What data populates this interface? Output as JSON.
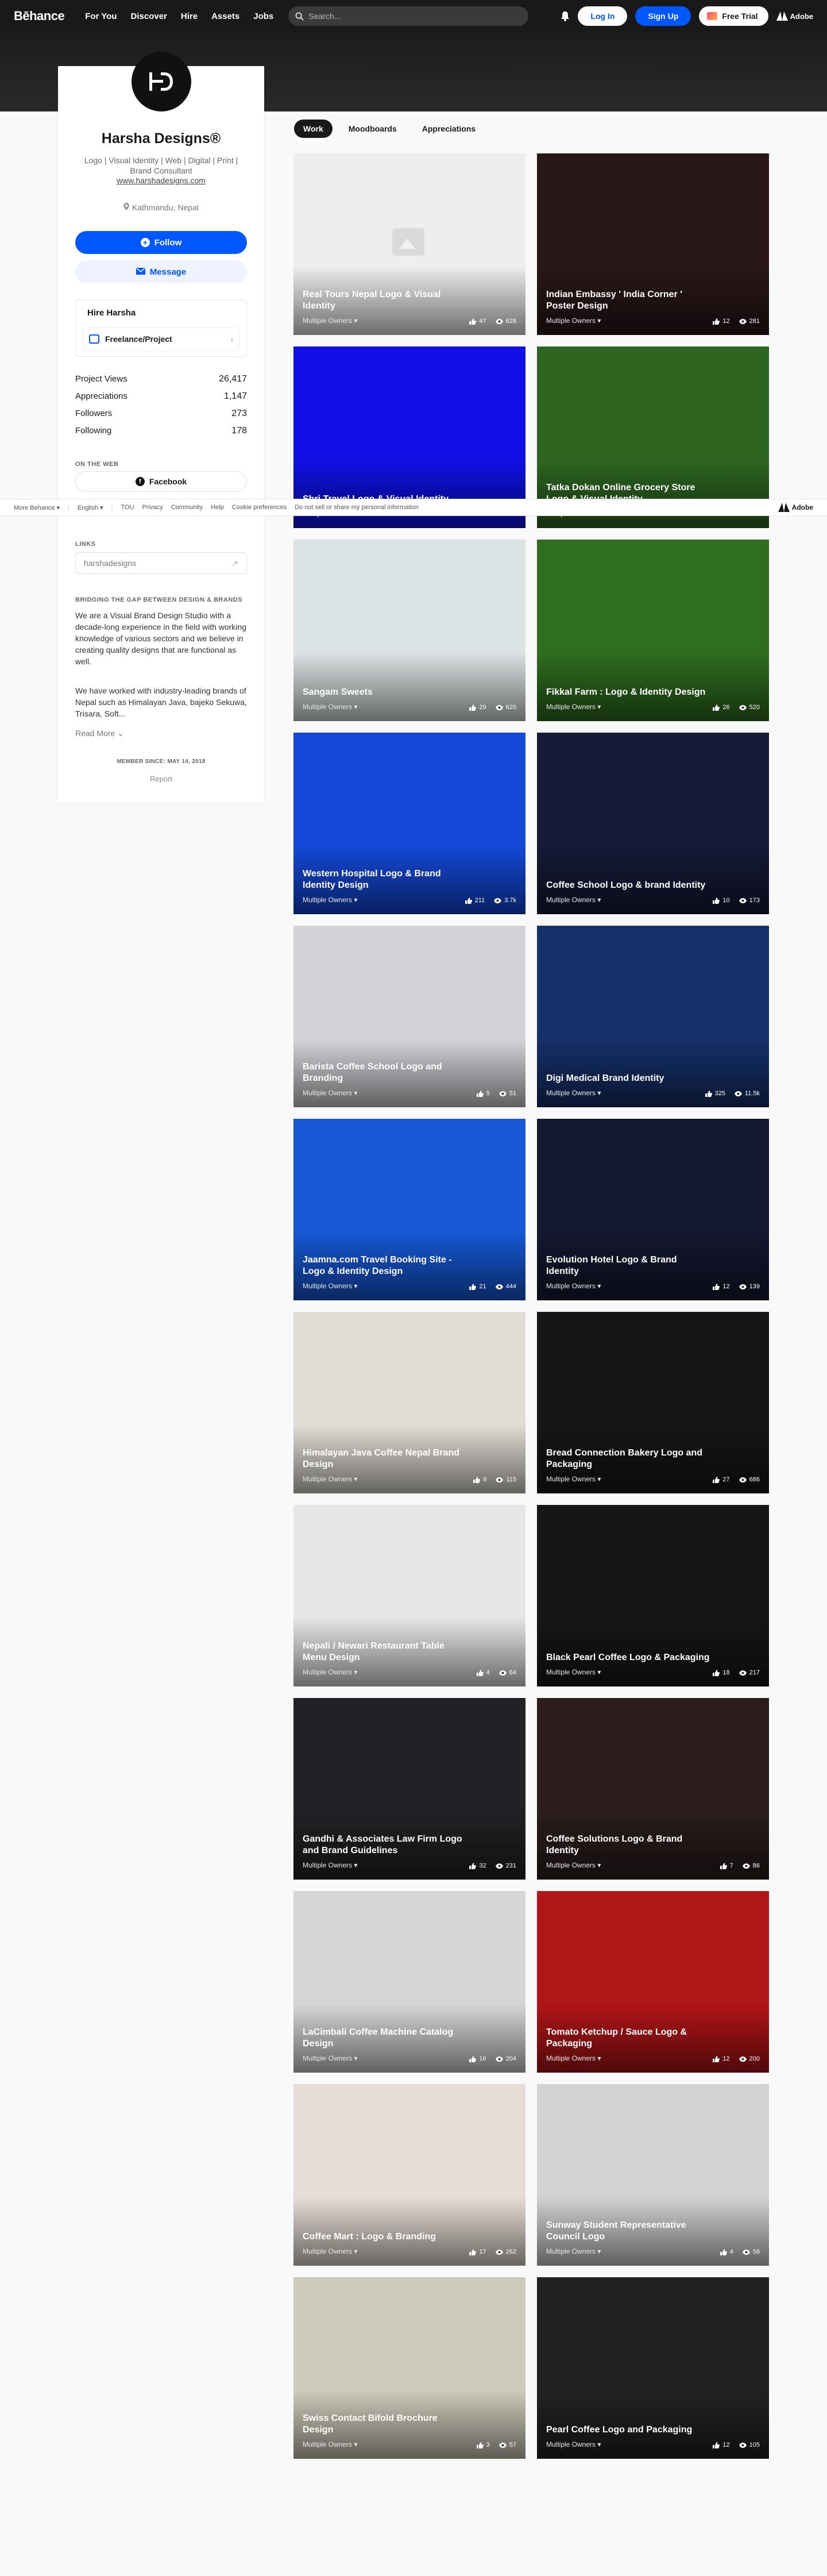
{
  "nav": {
    "logo": "Bēhance",
    "links": [
      "For You",
      "Discover",
      "Hire",
      "Assets",
      "Jobs"
    ],
    "search_placeholder": "Search...",
    "login": "Log In",
    "signup": "Sign Up",
    "free_trial": "Free Trial",
    "adobe": "Adobe"
  },
  "profile": {
    "name": "Harsha Designs®",
    "tagline": "Logo | Visual Identity | Web | Digital | Print | Brand Consultant",
    "website": "www.harshadesigns.com",
    "location": "Kathmandu, Nepal",
    "follow": "Follow",
    "message": "Message",
    "hire_title": "Hire Harsha",
    "hire_option": "Freelance/Project",
    "stats": [
      {
        "label": "Project Views",
        "value": "26,417"
      },
      {
        "label": "Appreciations",
        "value": "1,147"
      },
      {
        "label": "Followers",
        "value": "273"
      },
      {
        "label": "Following",
        "value": "178"
      }
    ],
    "on_the_web": "ON THE WEB",
    "facebook": "Facebook",
    "links_label": "LINKS",
    "link_value": "harshadesigns",
    "about_title": "BRIDGING THE GAP BETWEEN DESIGN & BRANDS",
    "about_p1": "We are a Visual Brand Design Studio with a decade-long experience in the field with working knowledge of various sectors and we believe in creating quality designs that are functional as well.",
    "about_p2": "We have worked with industry-leading brands of Nepal such as Himalayan Java, bajeko Sekuwa, Trisara, Soft...",
    "read_more": "Read More",
    "member_since": "MEMBER SINCE: MAY 14, 2018",
    "report": "Report"
  },
  "tabs": [
    "Work",
    "Moodboards",
    "Appreciations"
  ],
  "footer": {
    "items": [
      "More Behance ▾",
      "English ▾",
      "TOU",
      "Privacy",
      "Community",
      "Help",
      "Cookie preferences",
      "Do not sell or share my personal information"
    ],
    "adobe": "Adobe"
  },
  "projects": [
    {
      "title": "Real Tours Nepal Logo & Visual Identity",
      "owner": "Multiple Owners ▾",
      "likes": "47",
      "views": "628",
      "color": "#eeeeee",
      "placeholder": true
    },
    {
      "title": "Indian Embassy ' India Corner ' Poster Design",
      "owner": "Multiple Owners ▾",
      "likes": "12",
      "views": "281",
      "color": "#2a1718"
    },
    {
      "title": "Shri Travel Logo & Visual Identity",
      "owner": "Multiple Owners ▾",
      "likes": "",
      "views": "",
      "color": "#1010e6"
    },
    {
      "title": "Tatka Dokan Online Grocery Store Logo & Visual Identity",
      "owner": "Multiple Owners ▾",
      "likes": "",
      "views": "",
      "color": "#2d6621"
    },
    {
      "title": "Sangam Sweets",
      "owner": "Multiple Owners ▾",
      "likes": "29",
      "views": "620",
      "color": "#dce3e4"
    },
    {
      "title": "Fikkal Farm : Logo & Identity Design",
      "owner": "Multiple Owners ▾",
      "likes": "26",
      "views": "520",
      "color": "#2f6d1f"
    },
    {
      "title": "Western Hospital Logo & Brand Identity Design",
      "owner": "Multiple Owners ▾",
      "likes": "211",
      "views": "3.7k",
      "color": "#1448d8"
    },
    {
      "title": "Coffee School Logo & brand Identity",
      "owner": "Multiple Owners ▾",
      "likes": "10",
      "views": "173",
      "color": "#151a36"
    },
    {
      "title": "Barista Coffee School Logo and Branding",
      "owner": "Multiple Owners ▾",
      "likes": "5",
      "views": "51",
      "color": "#d3d4d9"
    },
    {
      "title": "Digi Medical Brand Identity",
      "owner": "Multiple Owners ▾",
      "likes": "325",
      "views": "11.5k",
      "color": "#16306a"
    },
    {
      "title": "Jaamna.com Travel Booking Site - Logo & Identity Design",
      "owner": "Multiple Owners ▾",
      "likes": "21",
      "views": "444",
      "color": "#1658d6"
    },
    {
      "title": "Evolution Hotel Logo & Brand Identity",
      "owner": "Multiple Owners ▾",
      "likes": "12",
      "views": "139",
      "color": "#141830"
    },
    {
      "title": "Himalayan Java Coffee Nepal Brand Design",
      "owner": "Multiple Owners ▾",
      "likes": "6",
      "views": "115",
      "color": "#e1dcd4"
    },
    {
      "title": "Bread Connection Bakery Logo and Packaging",
      "owner": "Multiple Owners ▾",
      "likes": "27",
      "views": "686",
      "color": "#161616"
    },
    {
      "title": "Nepali / Newari Restaurant Table Menu Design",
      "owner": "Multiple Owners ▾",
      "likes": "4",
      "views": "64",
      "color": "#e6e6e6"
    },
    {
      "title": "Black Pearl Coffee Logo & Packaging",
      "owner": "Multiple Owners ▾",
      "likes": "18",
      "views": "217",
      "color": "#161616"
    },
    {
      "title": "Gandhi & Associates Law Firm Logo and Brand Guidelines",
      "owner": "Multiple Owners ▾",
      "likes": "32",
      "views": "231",
      "color": "#222226"
    },
    {
      "title": "Coffee Solutions Logo & Brand Identity",
      "owner": "Multiple Owners ▾",
      "likes": "7",
      "views": "86",
      "color": "#2a1d1c"
    },
    {
      "title": "LaCimbali Coffee Machine Catalog Design",
      "owner": "Multiple Owners ▾",
      "likes": "16",
      "views": "204",
      "color": "#d6d6d6"
    },
    {
      "title": "Tomato Ketchup / Sauce Logo & Packaging",
      "owner": "Multiple Owners ▾",
      "likes": "12",
      "views": "200",
      "color": "#b01518"
    },
    {
      "title": "Coffee Mart : Logo & Branding",
      "owner": "Multiple Owners ▾",
      "likes": "17",
      "views": "262",
      "color": "#e7ddd6"
    },
    {
      "title": "Sunway Student Representative Council Logo",
      "owner": "Multiple Owners ▾",
      "likes": "4",
      "views": "58",
      "color": "#d2d2d2"
    },
    {
      "title": "Swiss Contact Bifold Brochure Design",
      "owner": "Multiple Owners ▾",
      "likes": "3",
      "views": "57",
      "color": "#cfcbbb"
    },
    {
      "title": "Pearl Coffee Logo and Packaging",
      "owner": "Multiple Owners ▾",
      "likes": "12",
      "views": "105",
      "color": "#222222"
    }
  ]
}
